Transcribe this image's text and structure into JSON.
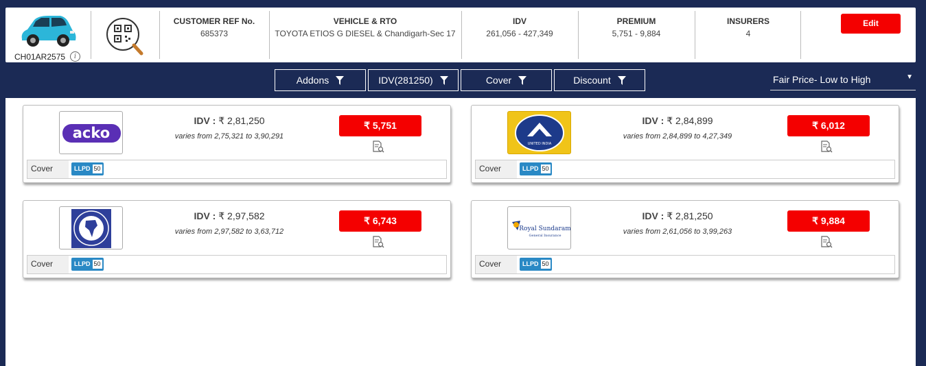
{
  "header": {
    "car_reg": "CH01AR2575",
    "info_glyph": "i",
    "columns": [
      {
        "title": "CUSTOMER REF No.",
        "value": "685373"
      },
      {
        "title": "VEHICLE & RTO",
        "value": "TOYOTA ETIOS G DIESEL & Chandigarh-Sec 17"
      },
      {
        "title": "IDV",
        "value": "261,056 - 427,349"
      },
      {
        "title": "PREMIUM",
        "value": "5,751 - 9,884"
      },
      {
        "title": "INSURERS",
        "value": "4"
      }
    ],
    "edit_label": "Edit"
  },
  "filters": [
    {
      "label": "Addons"
    },
    {
      "label": "IDV(281250)"
    },
    {
      "label": "Cover"
    },
    {
      "label": "Discount"
    }
  ],
  "sort": {
    "selected": "Fair Price- Low to High",
    "caret": "▼"
  },
  "quotes": [
    {
      "insurer": "acko",
      "idv": "₹ 2,81,250",
      "varies": "varies from 2,75,321 to 3,90,291",
      "premium": "₹ 5,751",
      "cover_label": "Cover",
      "cover_tag": "LLPD",
      "cover_value": "50"
    },
    {
      "insurer": "United India",
      "logo_text": "UNITED INDIA",
      "idv": "₹ 2,84,899",
      "varies": "varies from 2,84,899 to 4,27,349",
      "premium": "₹ 6,012",
      "cover_label": "Cover",
      "cover_tag": "LLPD",
      "cover_value": "50"
    },
    {
      "insurer": "New India Assurance",
      "idv": "₹ 2,97,582",
      "varies": "varies from 2,97,582 to 3,63,712",
      "premium": "₹ 6,743",
      "cover_label": "Cover",
      "cover_tag": "LLPD",
      "cover_value": "50"
    },
    {
      "insurer": "Royal Sundaram",
      "logo_text": "Royal Sundaram",
      "logo_sub": "General Insurance",
      "idv": "₹ 2,81,250",
      "varies": "varies from 2,61,056 to 3,99,263",
      "premium": "₹ 9,884",
      "cover_label": "Cover",
      "cover_tag": "LLPD",
      "cover_value": "50"
    }
  ],
  "idv_prefix": "IDV : ",
  "colors": {
    "navy": "#1b2a55",
    "accent_red": "#f40000",
    "llpd_blue": "#2a89c5"
  },
  "icons": [
    "car-image",
    "qr-search-icon",
    "info-icon",
    "filter-icon",
    "document-search-icon"
  ]
}
